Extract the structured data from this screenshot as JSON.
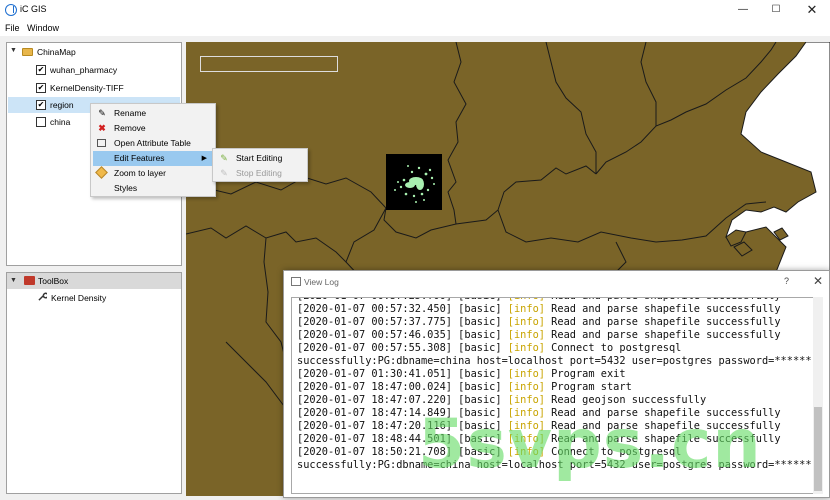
{
  "window": {
    "title": "iC GIS",
    "min_glyph": "—",
    "max_glyph": "☐",
    "close_glyph": "✕"
  },
  "menu": {
    "items": [
      "File",
      "Window"
    ]
  },
  "layers": {
    "root": "ChinaMap",
    "items": [
      {
        "label": "wuhan_pharmacy",
        "checked": true
      },
      {
        "label": "KernelDensity-TIFF",
        "checked": true
      },
      {
        "label": "region",
        "checked": true
      },
      {
        "label": "china",
        "checked": false
      }
    ]
  },
  "context_menu": {
    "items": [
      {
        "label": "Rename",
        "icon": "pencil-icon"
      },
      {
        "label": "Remove",
        "icon": "red-x-icon"
      },
      {
        "label": "Open Attribute Table",
        "icon": "table-icon"
      },
      {
        "label": "Edit Features",
        "icon": "",
        "submenu_arrow": "▶"
      },
      {
        "label": "Zoom to layer",
        "icon": "zoom-layer-icon"
      },
      {
        "label": "Styles",
        "icon": ""
      }
    ],
    "submenu": [
      {
        "label": "Start Editing",
        "enabled": true
      },
      {
        "label": "Stop Editing",
        "enabled": false
      }
    ]
  },
  "toolbox": {
    "title": "ToolBox",
    "items": [
      "Kernel Density"
    ]
  },
  "log_window": {
    "title": "View Log",
    "help": "?",
    "close": "✕",
    "lines": [
      {
        "ts": "[2020-01-07 00:57:25.?00]",
        "cat": "[basic]",
        "lvl": "[info]",
        "msg": "Read and parse shapefile successfully"
      },
      {
        "ts": "[2020-01-07 00:57:32.450]",
        "cat": "[basic]",
        "lvl": "[info]",
        "msg": "Read and parse shapefile successfully"
      },
      {
        "ts": "[2020-01-07 00:57:37.775]",
        "cat": "[basic]",
        "lvl": "[info]",
        "msg": "Read and parse shapefile successfully"
      },
      {
        "ts": "[2020-01-07 00:57:46.035]",
        "cat": "[basic]",
        "lvl": "[info]",
        "msg": "Read and parse shapefile successfully"
      },
      {
        "ts": "[2020-01-07 00:57:55.308]",
        "cat": "[basic]",
        "lvl": "[info]",
        "msg": "Connect to postgresql"
      },
      {
        "raw": "successfully:PG:dbname=china host=localhost port=5432 user=postgres password=******"
      },
      {
        "ts": "[2020-01-07 01:30:41.051]",
        "cat": "[basic]",
        "lvl": "[info]",
        "msg": "Program exit"
      },
      {
        "ts": "[2020-01-07 18:47:00.024]",
        "cat": "[basic]",
        "lvl": "[info]",
        "msg": "Program start"
      },
      {
        "ts": "[2020-01-07 18:47:07.220]",
        "cat": "[basic]",
        "lvl": "[info]",
        "msg": "Read geojson successfully"
      },
      {
        "ts": "[2020-01-07 18:47:14.849]",
        "cat": "[basic]",
        "lvl": "[info]",
        "msg": "Read and parse shapefile successfully"
      },
      {
        "ts": "[2020-01-07 18:47:20.116]",
        "cat": "[basic]",
        "lvl": "[info]",
        "msg": "Read and parse shapefile successfully"
      },
      {
        "ts": "[2020-01-07 18:48:44.501]",
        "cat": "[basic]",
        "lvl": "[info]",
        "msg": "Read and parse shapefile successfully"
      },
      {
        "ts": "[2020-01-07 18:50:21.708]",
        "cat": "[basic]",
        "lvl": "[info]",
        "msg": "Connect to postgresql"
      },
      {
        "raw": "successfully:PG:dbname=china host=localhost port=5432 user=postgres password=******"
      }
    ]
  },
  "watermark": "5svps.cn",
  "colors": {
    "map_fill": "#7a6428",
    "map_border": "#1a1a1a",
    "density_points": "#a8f0b0",
    "info_level": "#c8a400",
    "selection": "#99c9ef"
  }
}
